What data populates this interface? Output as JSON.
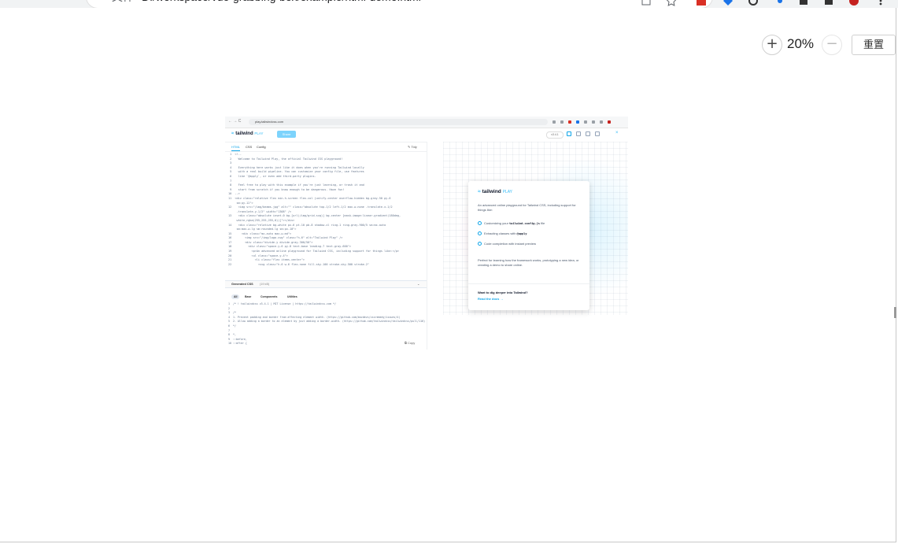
{
  "browser": {
    "address_label": "文件",
    "address_url": "D:/workspace/vue-grabbing-box/example/html-demo.html"
  },
  "viewer": {
    "zoom_in_label": "+",
    "zoom_level": "20%",
    "zoom_out_label": "−",
    "reset_label": "重置"
  },
  "screenshot": {
    "chrome": {
      "nav": "← →  C",
      "url": "play.tailwindcss.com"
    },
    "header": {
      "logo": "tailwind",
      "logo_suffix": "PLAY",
      "share": "Share",
      "version": "v3.4.1"
    },
    "editor_tabs": [
      "HTML",
      "CSS",
      "Config"
    ],
    "tidy": "Tidy",
    "code_lines": [
      " 1  <!--",
      " 2    Welcome to Tailwind Play, the official Tailwind CSS playground!",
      " 3",
      " 4    Everything here works just like it does when you're running Tailwind locally",
      " 5    with a real build pipeline. You can customize your config file, use features",
      " 6    like `@apply`, or even add third-party plugins.",
      " 7",
      " 8    Feel free to play with this example if you're just learning, or trash it and",
      " 9    start from scratch if you know enough to be dangerous. Have fun!",
      "10  -->",
      "11  <div class=\"relative flex min-h-screen flex-col justify-center overflow-hidden bg-gray-50 py-6",
      "     sm:py-12\">",
      "12    <img src=\"/img/beams.jpg\" alt=\"\" class=\"absolute top-1/2 left-1/2 max-w-none -translate-x-1/2",
      "     -translate-y-1/2\" width=\"1308\" />",
      "13    <div class=\"absolute inset-0 bg-[url(/img/grid.svg)] bg-center [mask-image:linear-gradient(180deg,",
      "     white,rgba(255,255,255,0))]\"></div>",
      "14    <div class=\"relative bg-white px-6 pt-10 pb-8 shadow-xl ring-1 ring-gray-900/5 sm:mx-auto",
      "     sm:max-w-lg sm:rounded-lg sm:px-10\">",
      "15      <div class=\"mx-auto max-w-md\">",
      "16        <img src=\"/img/logo.svg\" class=\"h-6\" alt=\"Tailwind Play\" />",
      "17        <div class=\"divide-y divide-gray-300/50\">",
      "18          <div class=\"space-y-6 py-8 text-base leading-7 text-gray-600\">",
      "19            <p>An advanced online playground for Tailwind CSS, including support for things like:</p>",
      "20            <ul class=\"space-y-4\">",
      "21              <li class=\"flex items-center\">",
      "22                <svg class=\"h-6 w-6 flex-none fill-sky-100 stroke-sky-500 stroke-2\""
    ],
    "generated_css_label": "Generated CSS",
    "generated_css_size": "(19 kB)",
    "css_tabs": [
      "All",
      "Base",
      "Components",
      "Utilities"
    ],
    "css_lines": [
      "1  /* ! tailwindcss v3.4.1 | MIT License | https://tailwindcss.com */",
      "2",
      "3  /*",
      "4  1. Prevent padding and border from affecting element width. (https://github.com/mozdevs/cssremedy/issues/4)",
      "5  2. Allow adding a border to an element by just adding a border-width. (https://github.com/tailwindcss/tailwindcss/pull/116)",
      "6  */",
      "7",
      "8  *,",
      "9  ::before,",
      "10 ::after {"
    ],
    "copy": "Copy",
    "card": {
      "logo": "tailwind",
      "logo_suffix": "PLAY",
      "intro": "An advanced online playground for Tailwind CSS, including support for things like:",
      "features": [
        {
          "pre": "Customizing your ",
          "code": "tailwind.config.js",
          "post": " file"
        },
        {
          "pre": "Extracting classes with ",
          "code": "@apply",
          "post": ""
        },
        {
          "pre": "Code completion with instant preview",
          "code": "",
          "post": ""
        }
      ],
      "perfect": "Perfect for learning how the framework works, prototyping a new idea, or creating a demo to share online.",
      "deeper": "Want to dig deeper into Tailwind?",
      "docs": "Read the docs →"
    }
  }
}
